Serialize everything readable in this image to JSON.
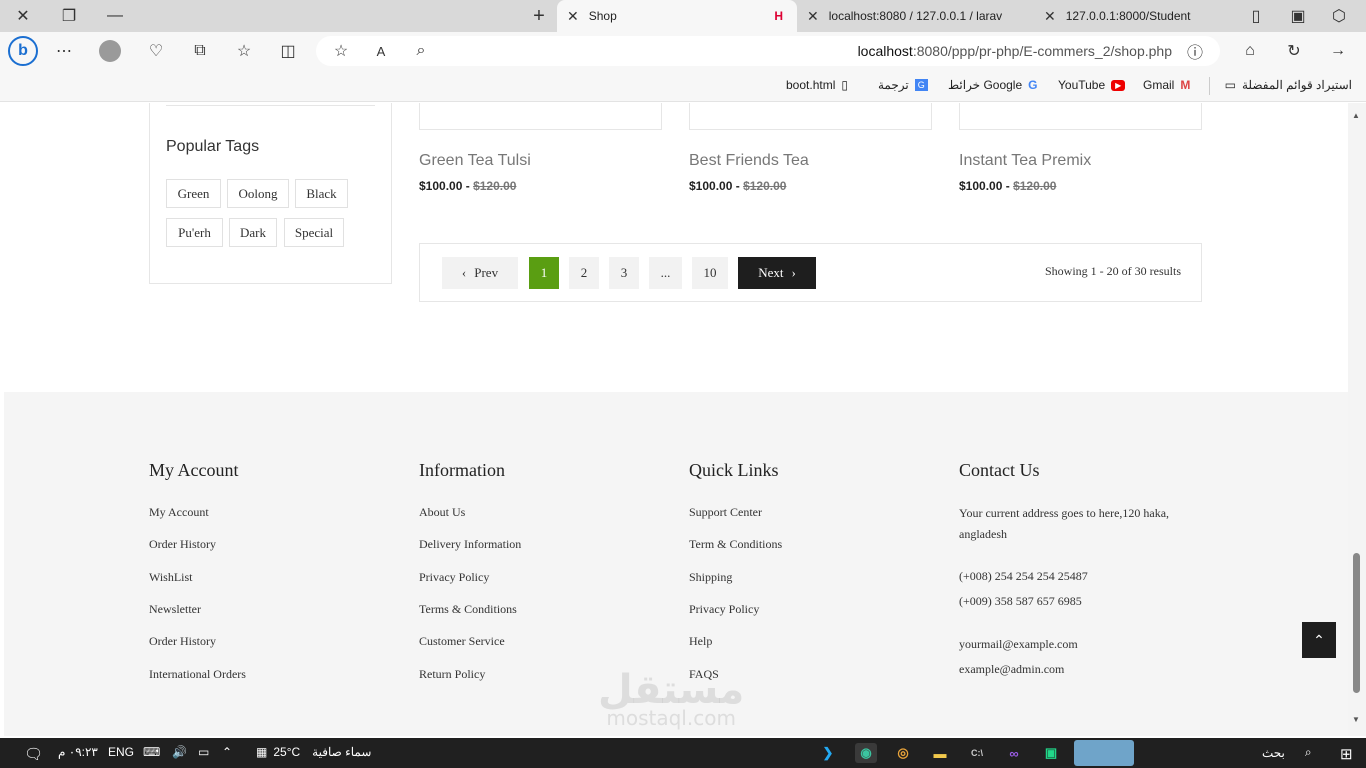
{
  "browser": {
    "tabs": [
      {
        "label": "Shop"
      },
      {
        "label": "localhost:8080 / 127.0.0.1 / larav"
      },
      {
        "label": "127.0.0.1:8000/Student"
      }
    ],
    "url_host": "localhost",
    "url_rest": ":8080/ppp/pr-php/E-commers_2/shop.php",
    "bookmarks": [
      {
        "label": "استيراد قوائم المفضلة"
      },
      {
        "label": "Gmail"
      },
      {
        "label": "YouTube"
      },
      {
        "label": "خرائط Google"
      },
      {
        "label": "ترجمة"
      },
      {
        "label": "boot.html"
      }
    ]
  },
  "sidebar": {
    "tags_title": "Popular Tags",
    "tags": [
      "Green",
      "Oolong",
      "Black",
      "Pu'erh",
      "Dark",
      "Special"
    ]
  },
  "products": [
    {
      "name": "Green Tea Tulsi",
      "price": "$100.00",
      "old_price": "$120.00"
    },
    {
      "name": "Best Friends Tea",
      "price": "$100.00",
      "old_price": "$120.00"
    },
    {
      "name": "Instant Tea Premix",
      "price": "$100.00",
      "old_price": "$120.00"
    }
  ],
  "pagination": {
    "prev": "Prev",
    "pages": [
      "1",
      "2",
      "3",
      "...",
      "10"
    ],
    "current": "1",
    "next": "Next",
    "showing": "Showing 1 - 20 of 30 results",
    "accent": "#5a9e12"
  },
  "footer": {
    "my_account": {
      "title": "My Account",
      "links": [
        "My Account",
        "Order History",
        "WishList",
        "Newsletter",
        "Order History",
        "International Orders"
      ]
    },
    "information": {
      "title": "Information",
      "links": [
        "About Us",
        "Delivery Information",
        "Privacy Policy",
        "Terms & Conditions",
        "Customer Service",
        "Return Policy"
      ]
    },
    "quick_links": {
      "title": "Quick Links",
      "links": [
        "Support Center",
        "Term & Conditions",
        "Shipping",
        "Privacy Policy",
        "Help",
        "FAQS"
      ]
    },
    "contact": {
      "title": "Contact Us",
      "address_line1": "Your current address goes to here,120 haka,",
      "address_line2": "angladesh",
      "phone1": "(+008) 254 254 254 25487",
      "phone2": "(+009) 358 587 657 6985",
      "email1": "yourmail@example.com",
      "email2": "example@admin.com"
    }
  },
  "watermark": {
    "arabic": "مستقل",
    "latin": "mostaql.com"
  },
  "taskbar": {
    "search": "بحث",
    "weather_temp": "25°C",
    "weather_text": "سماء صافية",
    "lang": "ENG",
    "time": "٠٩:٢٣ م"
  }
}
